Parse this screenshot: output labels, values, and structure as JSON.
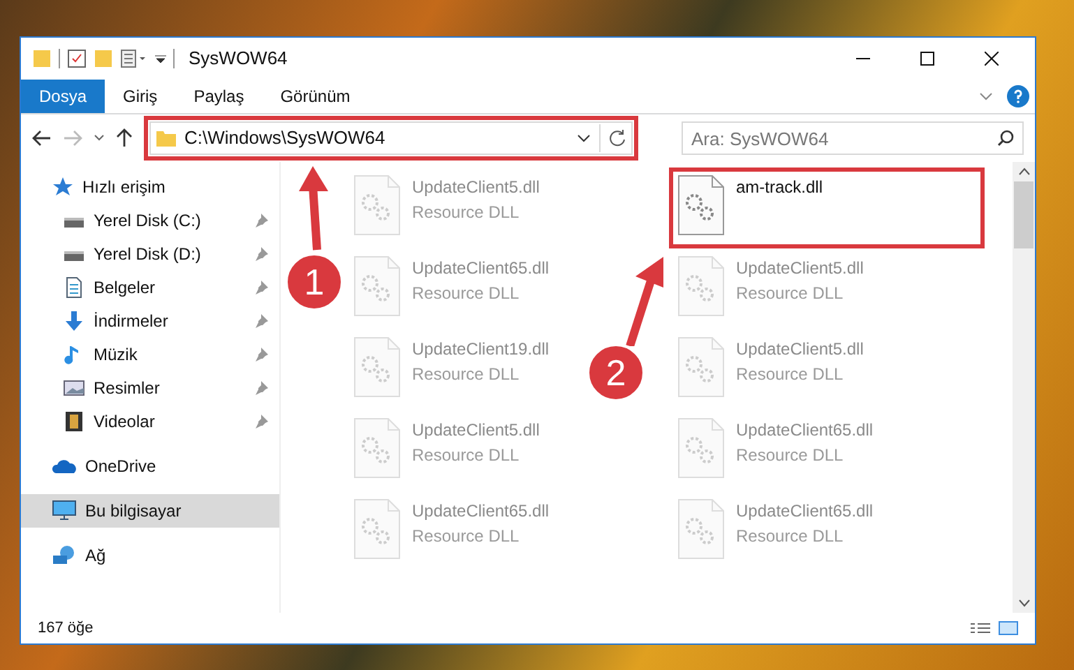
{
  "window": {
    "title": "SysWOW64"
  },
  "ribbon_tabs": [
    {
      "label": "Dosya",
      "selected": true
    },
    {
      "label": "Giriş",
      "selected": false
    },
    {
      "label": "Paylaş",
      "selected": false
    },
    {
      "label": "Görünüm",
      "selected": false
    }
  ],
  "address_bar": {
    "path": "C:\\Windows\\SysWOW64",
    "highlighted": true
  },
  "search": {
    "placeholder": "Ara: SysWOW64"
  },
  "sidebar": {
    "items": [
      {
        "label": "Hızlı erişim",
        "kind": "star",
        "pinned": false,
        "selected": false,
        "children": [
          {
            "label": "Yerel Disk (C:)",
            "kind": "drive",
            "pinned": true,
            "selected": false
          },
          {
            "label": "Yerel Disk (D:)",
            "kind": "drive",
            "pinned": true,
            "selected": false
          },
          {
            "label": "Belgeler",
            "kind": "document",
            "pinned": true,
            "selected": false
          },
          {
            "label": "İndirmeler",
            "kind": "download",
            "pinned": true,
            "selected": false
          },
          {
            "label": "Müzik",
            "kind": "music",
            "pinned": true,
            "selected": false
          },
          {
            "label": "Resimler",
            "kind": "picture",
            "pinned": true,
            "selected": false
          },
          {
            "label": "Videolar",
            "kind": "video",
            "pinned": true,
            "selected": false
          }
        ]
      },
      {
        "label": "OneDrive",
        "kind": "cloud",
        "pinned": false,
        "selected": false
      },
      {
        "label": "Bu bilgisayar",
        "kind": "computer",
        "pinned": false,
        "selected": true
      },
      {
        "label": "Ağ",
        "kind": "network",
        "pinned": false,
        "selected": false
      }
    ]
  },
  "files": [
    {
      "name": "UpdateClient5.dll",
      "type": "Resource DLL",
      "blurred": true,
      "highlighted": false
    },
    {
      "name": "am-track.dll",
      "blurred": false,
      "highlighted": true
    },
    {
      "name": "UpdateClient65.dll",
      "type": "Resource DLL",
      "blurred": true,
      "highlighted": false
    },
    {
      "name": "UpdateClient5.dll",
      "type": "Resource DLL",
      "blurred": true,
      "highlighted": false
    },
    {
      "name": "UpdateClient19.dll",
      "type": "Resource DLL",
      "blurred": true,
      "highlighted": false
    },
    {
      "name": "UpdateClient5.dll",
      "type": "Resource DLL",
      "blurred": true,
      "highlighted": false
    },
    {
      "name": "UpdateClient5.dll",
      "type": "Resource DLL",
      "blurred": true,
      "highlighted": false
    },
    {
      "name": "UpdateClient65.dll",
      "type": "Resource DLL",
      "blurred": true,
      "highlighted": false
    },
    {
      "name": "UpdateClient65.dll",
      "type": "Resource DLL",
      "blurred": true,
      "highlighted": false
    },
    {
      "name": "UpdateClient65.dll",
      "type": "Resource DLL",
      "blurred": true,
      "highlighted": false
    }
  ],
  "status_bar": {
    "item_count": "167 öğe"
  },
  "annotations": [
    {
      "number": "1"
    },
    {
      "number": "2"
    }
  ]
}
